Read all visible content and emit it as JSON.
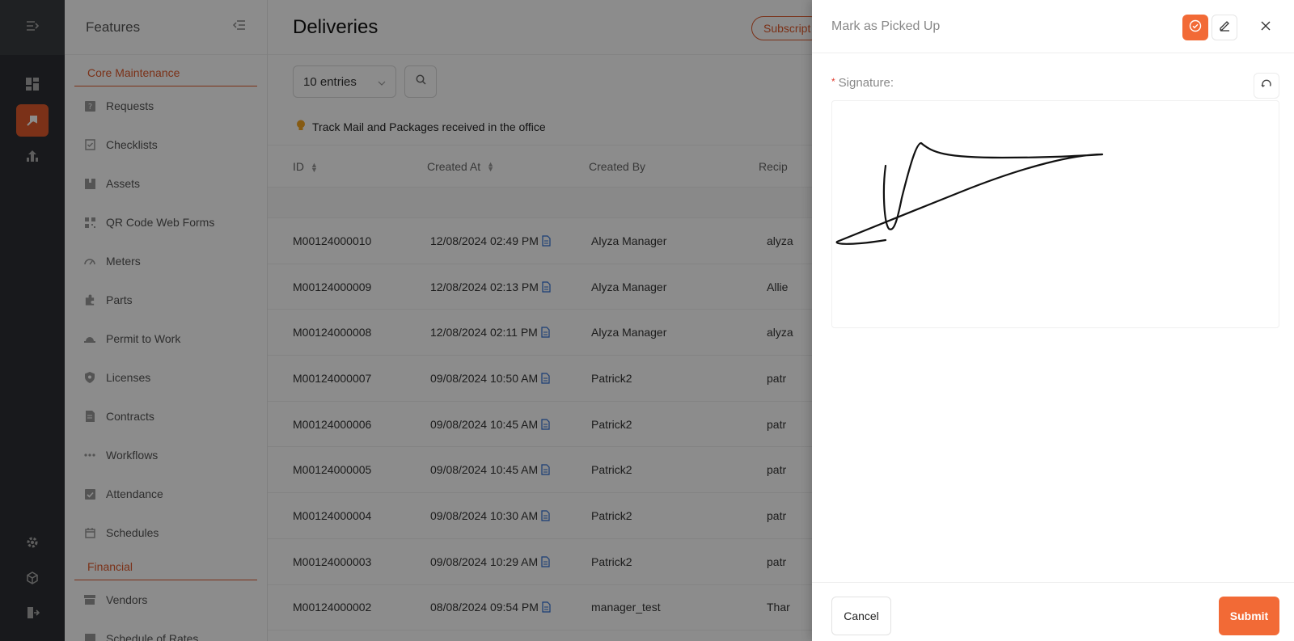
{
  "rail": {
    "icons": [
      "menu-expand-icon",
      "dashboard-icon",
      "maintenance-icon",
      "reports-icon",
      "gear-icon",
      "cube-icon",
      "logout-icon"
    ],
    "accent": "#e05a2c"
  },
  "features": {
    "title": "Features",
    "sections": [
      {
        "label": "Core Maintenance",
        "items": [
          "Requests",
          "Checklists",
          "Assets",
          "QR Code Web Forms",
          "Meters",
          "Parts",
          "Permit to Work",
          "Licenses",
          "Contracts",
          "Workflows",
          "Attendance",
          "Schedules"
        ]
      },
      {
        "label": "Financial",
        "items": [
          "Vendors",
          "Schedule of Rates"
        ]
      }
    ]
  },
  "main": {
    "title": "Deliveries",
    "subscribe_label": "Subscript",
    "entries_label": "10 entries",
    "info_text": "Track Mail and Packages received in the office",
    "columns": [
      "ID",
      "Created At",
      "Created By",
      "Recip"
    ],
    "rows": [
      {
        "id": "M00124000010",
        "created_at": "12/08/2024 02:49 PM",
        "created_by": "Alyza Manager",
        "recipient": "alyza"
      },
      {
        "id": "M00124000009",
        "created_at": "12/08/2024 02:13 PM",
        "created_by": "Alyza Manager",
        "recipient": "Allie"
      },
      {
        "id": "M00124000008",
        "created_at": "12/08/2024 02:11 PM",
        "created_by": "Alyza Manager",
        "recipient": "alyza"
      },
      {
        "id": "M00124000007",
        "created_at": "09/08/2024 10:50 AM",
        "created_by": "Patrick2",
        "recipient": "patr"
      },
      {
        "id": "M00124000006",
        "created_at": "09/08/2024 10:45 AM",
        "created_by": "Patrick2",
        "recipient": "patr"
      },
      {
        "id": "M00124000005",
        "created_at": "09/08/2024 10:45 AM",
        "created_by": "Patrick2",
        "recipient": "patr"
      },
      {
        "id": "M00124000004",
        "created_at": "09/08/2024 10:30 AM",
        "created_by": "Patrick2",
        "recipient": "patr"
      },
      {
        "id": "M00124000003",
        "created_at": "09/08/2024 10:29 AM",
        "created_by": "Patrick2",
        "recipient": "patr"
      },
      {
        "id": "M00124000002",
        "created_at": "08/08/2024 09:54 PM",
        "created_by": "manager_test",
        "recipient": "Thar"
      }
    ]
  },
  "drawer": {
    "title": "Mark as Picked Up",
    "signature_label": "Signature",
    "required_mark": "*",
    "label_suffix": ":",
    "cancel_label": "Cancel",
    "submit_label": "Submit",
    "accent": "#f26a36"
  }
}
